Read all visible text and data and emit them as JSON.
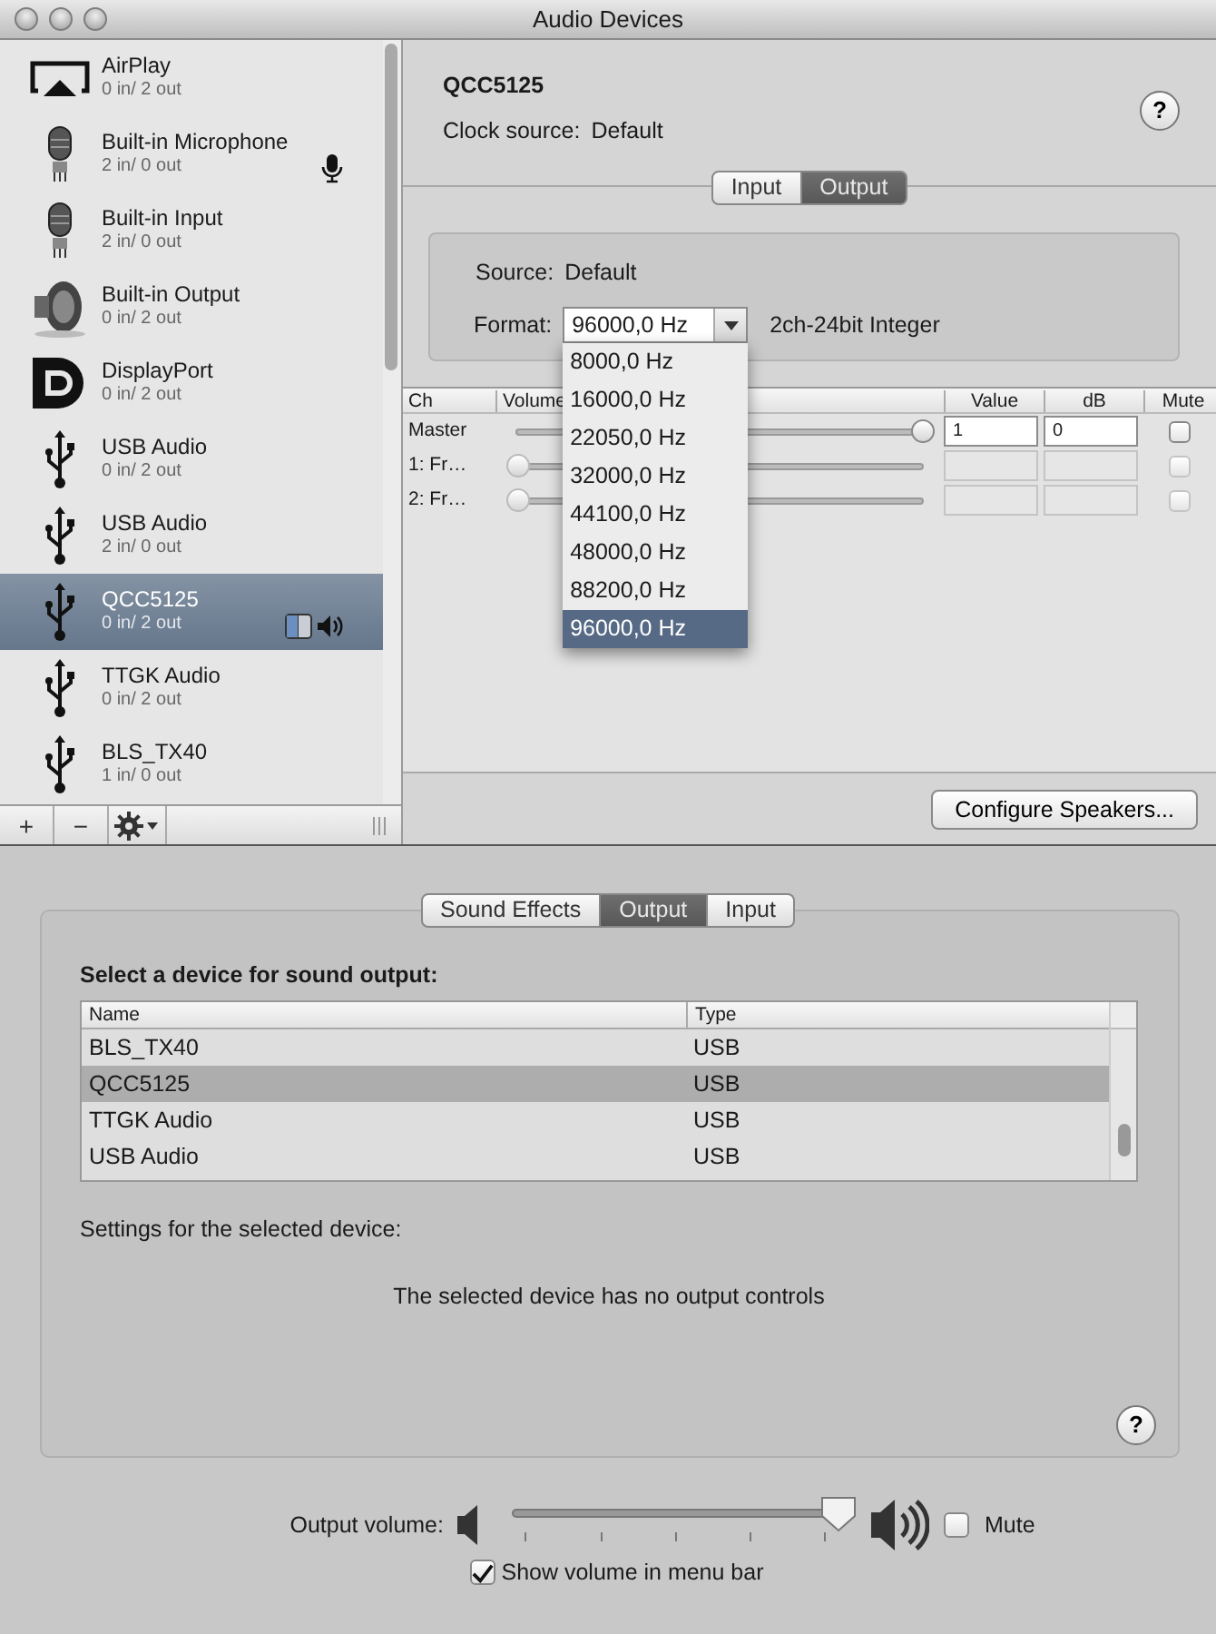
{
  "window": {
    "title": "Audio Devices"
  },
  "devices": [
    {
      "name": "AirPlay",
      "io": "0 in/ 2 out",
      "kind": "airplay",
      "selected": false,
      "default_input": false,
      "system_output": false,
      "default_output": false
    },
    {
      "name": "Built-in Microphone",
      "io": "2 in/ 0 out",
      "kind": "mic",
      "selected": false,
      "default_input": true,
      "system_output": false,
      "default_output": false
    },
    {
      "name": "Built-in Input",
      "io": "2 in/ 0 out",
      "kind": "mic",
      "selected": false,
      "default_input": false,
      "system_output": false,
      "default_output": false
    },
    {
      "name": "Built-in Output",
      "io": "0 in/ 2 out",
      "kind": "speaker",
      "selected": false,
      "default_input": false,
      "system_output": false,
      "default_output": false
    },
    {
      "name": "DisplayPort",
      "io": "0 in/ 2 out",
      "kind": "displayport",
      "selected": false,
      "default_input": false,
      "system_output": false,
      "default_output": false
    },
    {
      "name": "USB Audio",
      "io": "0 in/ 2 out",
      "kind": "usb",
      "selected": false,
      "default_input": false,
      "system_output": false,
      "default_output": false
    },
    {
      "name": "USB Audio",
      "io": "2 in/ 0 out",
      "kind": "usb",
      "selected": false,
      "default_input": false,
      "system_output": false,
      "default_output": false
    },
    {
      "name": "QCC5125",
      "io": "0 in/ 2 out",
      "kind": "usb",
      "selected": true,
      "default_input": false,
      "system_output": true,
      "default_output": true
    },
    {
      "name": "TTGK Audio",
      "io": "0 in/ 2 out",
      "kind": "usb",
      "selected": false,
      "default_input": false,
      "system_output": false,
      "default_output": false
    },
    {
      "name": "BLS_TX40",
      "io": "1 in/ 0 out",
      "kind": "usb",
      "selected": false,
      "default_input": false,
      "system_output": false,
      "default_output": false
    }
  ],
  "sidebar_toolbar": {
    "add": "+",
    "remove": "−"
  },
  "device": {
    "name": "QCC5125",
    "clock_label": "Clock source:",
    "clock_value": "Default",
    "help": "?"
  },
  "io_tabs": [
    {
      "label": "Input",
      "selected": false
    },
    {
      "label": "Output",
      "selected": true
    }
  ],
  "stream": {
    "source_label": "Source:",
    "source_value": "Default",
    "format_label": "Format:",
    "format_value": "96000,0 Hz",
    "format_desc": "2ch-24bit Integer",
    "format_options": [
      {
        "label": "8000,0 Hz",
        "selected": false
      },
      {
        "label": "16000,0 Hz",
        "selected": false
      },
      {
        "label": "22050,0 Hz",
        "selected": false
      },
      {
        "label": "32000,0 Hz",
        "selected": false
      },
      {
        "label": "44100,0 Hz",
        "selected": false
      },
      {
        "label": "48000,0 Hz",
        "selected": false
      },
      {
        "label": "88200,0 Hz",
        "selected": false
      },
      {
        "label": "96000,0 Hz",
        "selected": true
      }
    ]
  },
  "channels": {
    "columns": [
      "Ch",
      "Volume",
      "Value",
      "dB",
      "Mute"
    ],
    "rows": [
      {
        "name": "Master",
        "level": 1,
        "value": "1",
        "db": "0",
        "muted": false,
        "disabled": false
      },
      {
        "name": "1: Fr…",
        "level": 0,
        "muted": false,
        "disabled": true
      },
      {
        "name": "2: Fr…",
        "level": 0,
        "muted": false,
        "disabled": true
      }
    ]
  },
  "configure_button": "Configure Speakers...",
  "prefs": {
    "tabs": [
      {
        "label": "Sound Effects",
        "selected": false
      },
      {
        "label": "Output",
        "selected": true
      },
      {
        "label": "Input",
        "selected": false
      }
    ],
    "heading": "Select a device for sound output:",
    "table": {
      "columns": [
        "Name",
        "Type"
      ],
      "rows": [
        {
          "name": "BLS_TX40",
          "type": "USB",
          "selected": false
        },
        {
          "name": "QCC5125",
          "type": "USB",
          "selected": true
        },
        {
          "name": "TTGK Audio",
          "type": "USB",
          "selected": false
        },
        {
          "name": "USB Audio",
          "type": "USB",
          "selected": false
        }
      ]
    },
    "settings_label": "Settings for the selected device:",
    "message": "The selected device has no output controls",
    "help": "?"
  },
  "volume": {
    "label": "Output volume:",
    "level": 1,
    "muted": false,
    "mute_label": "Mute",
    "show_in_menu_bar": true,
    "show_label": "Show volume in menu bar"
  }
}
